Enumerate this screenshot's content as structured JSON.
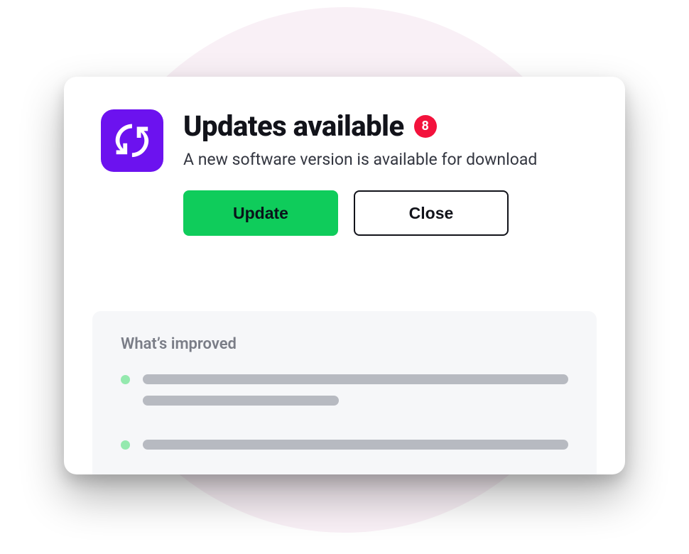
{
  "dialog": {
    "title": "Updates available",
    "badge_count": "8",
    "subtitle": "A new software version is available for download",
    "update_label": "Update",
    "close_label": "Close",
    "improved_heading": "What’s improved",
    "icon_name": "sync-icon"
  },
  "colors": {
    "icon_bg": "#6c12ef",
    "badge": "#f3123c",
    "primary_button": "#0fcc5b",
    "bullet": "#94e9ae"
  }
}
